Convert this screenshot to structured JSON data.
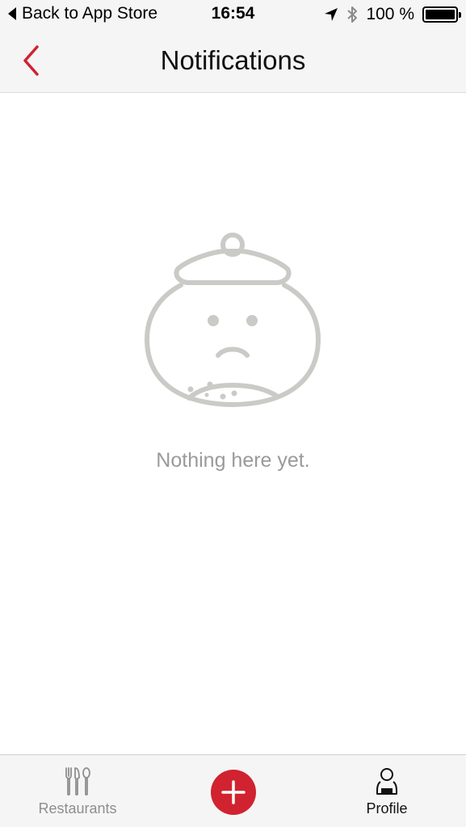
{
  "status_bar": {
    "back_to_app": "Back to App Store",
    "time": "16:54",
    "battery": "100 %",
    "battery_level": 1.0,
    "location_icon": "location-arrow-icon",
    "bluetooth_icon": "bluetooth-icon"
  },
  "nav": {
    "title": "Notifications",
    "back_icon": "chevron-left-icon"
  },
  "empty_state": {
    "illustration": "sad-jar-icon",
    "message": "Nothing here yet."
  },
  "tab_bar": {
    "restaurants_label": "Restaurants",
    "add_icon": "plus-icon",
    "profile_label": "Profile"
  },
  "colors": {
    "accent": "#d1222f",
    "illustration": "#cacac6",
    "muted_text": "#9a9a9a"
  }
}
